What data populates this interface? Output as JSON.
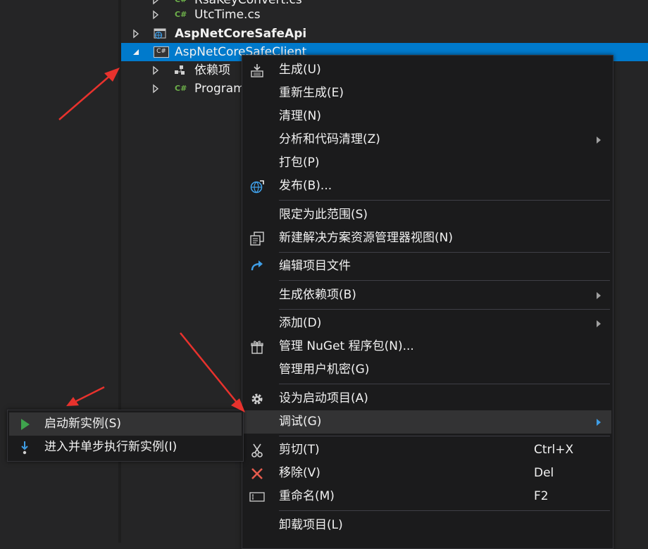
{
  "tree": {
    "items": [
      {
        "label": "RsaKeyConvert.cs",
        "icon": "csharp-file-icon"
      },
      {
        "label": "UtcTime.cs",
        "icon": "csharp-file-icon"
      },
      {
        "label": "AspNetCoreSafeApi",
        "icon": "web-project-icon"
      },
      {
        "label": "AspNetCoreSafeClient",
        "icon": "csharp-project-icon"
      },
      {
        "label": "依赖项",
        "icon": "dependencies-icon"
      },
      {
        "label": "Program.cs",
        "icon": "csharp-file-icon"
      }
    ],
    "cs_glyph": "C#",
    "proj_glyph": "C#"
  },
  "context_menu": {
    "items": [
      {
        "label": "生成(U)",
        "icon": "build-icon"
      },
      {
        "label": "重新生成(E)"
      },
      {
        "label": "清理(N)"
      },
      {
        "label": "分析和代码清理(Z)",
        "has_submenu": true
      },
      {
        "label": "打包(P)"
      },
      {
        "label": "发布(B)...",
        "icon": "publish-globe-icon"
      },
      {
        "label": "限定为此范围(S)"
      },
      {
        "label": "新建解决方案资源管理器视图(N)",
        "icon": "new-view-icon"
      },
      {
        "label": "编辑项目文件",
        "icon": "edit-redo-icon"
      },
      {
        "label": "生成依赖项(B)",
        "has_submenu": true
      },
      {
        "label": "添加(D)",
        "has_submenu": true
      },
      {
        "label": "管理 NuGet 程序包(N)...",
        "icon": "nuget-package-icon"
      },
      {
        "label": "管理用户机密(G)"
      },
      {
        "label": "设为启动项目(A)",
        "icon": "gear-icon"
      },
      {
        "label": "调试(G)",
        "has_submenu": true,
        "highlighted": true
      },
      {
        "label": "剪切(T)",
        "shortcut": "Ctrl+X",
        "icon": "scissors-icon"
      },
      {
        "label": "移除(V)",
        "shortcut": "Del",
        "icon": "remove-x-icon"
      },
      {
        "label": "重命名(M)",
        "shortcut": "F2",
        "icon": "rename-icon"
      },
      {
        "label": "卸载项目(L)"
      }
    ]
  },
  "debug_submenu": {
    "items": [
      {
        "label": "启动新实例(S)",
        "icon": "play-icon",
        "highlighted": true
      },
      {
        "label": "进入并单步执行新实例(I)",
        "icon": "step-into-icon"
      }
    ]
  },
  "colors": {
    "background": "#252526",
    "selection": "#007acc",
    "menu_bg": "#1b1b1c",
    "annotation_arrow": "#e8322d",
    "csharp_green": "#6db04a",
    "play_green": "#3fa34d",
    "remove_red": "#e55b4d"
  }
}
